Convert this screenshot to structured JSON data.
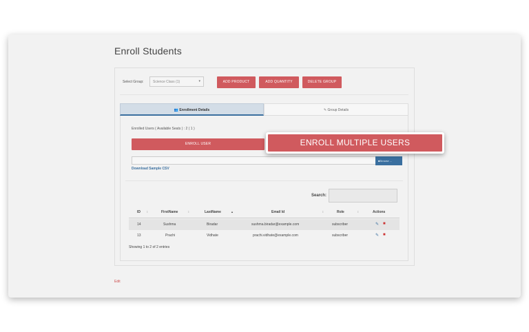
{
  "page": {
    "title": "Enroll Students"
  },
  "group": {
    "label": "Select Group:",
    "selected": "Science Class (1)",
    "add_product": "ADD PRODUCT",
    "add_quantity": "ADD QUANTITY",
    "delete_group": "DELETE GROUP"
  },
  "tabs": [
    {
      "label": "Enrollment Details",
      "icon": "users-icon",
      "active": true
    },
    {
      "label": "Group Details",
      "icon": "edit-icon",
      "active": false
    }
  ],
  "enrollment": {
    "enrolled_text": "Enrolled Users ( Available Seats ) : 2 ( 1 )",
    "enroll_user": "ENROLL USER",
    "browse": "Browse ...",
    "download_csv": "Download Sample CSV"
  },
  "table": {
    "search_label": "Search:",
    "headers": {
      "id": "ID",
      "first": "FirstName",
      "last": "LastName",
      "email": "Email Id",
      "role": "Role",
      "actions": "Actions"
    },
    "rows": [
      {
        "id": "14",
        "first": "Sushma",
        "last": "Biradar",
        "email": "sushma.biradar@example.com",
        "role": "subscriber"
      },
      {
        "id": "13",
        "first": "Prachi",
        "last": "Vidhate",
        "email": "prachi.vidhate@example.com",
        "role": "subscriber"
      }
    ],
    "showing": "Showing 1 to 2 of 2 entries"
  },
  "footer": {
    "edit": "Edit"
  },
  "highlight": {
    "label": "ENROLL MULTIPLE USERS"
  },
  "colors": {
    "accent_red": "#d05a5e",
    "accent_blue": "#3a6f9f"
  }
}
